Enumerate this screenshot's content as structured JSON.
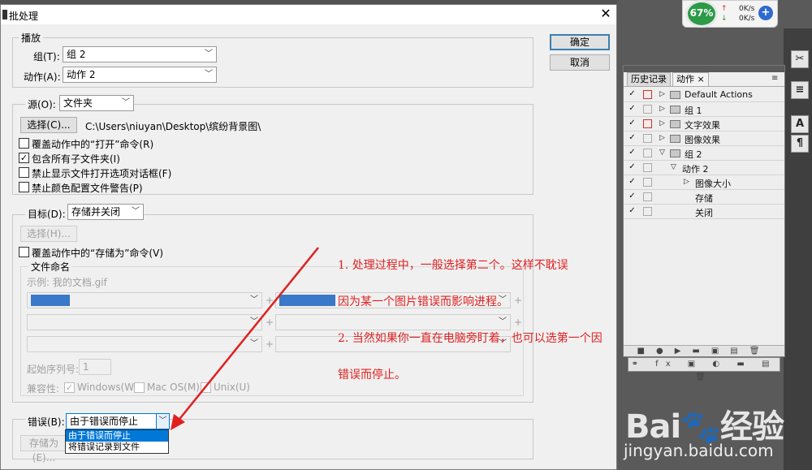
{
  "dialog": {
    "title": "批处理",
    "ok_label": "确定",
    "cancel_label": "取消",
    "play": {
      "legend": "播放",
      "set_label": "组(T):",
      "set_value": "组 2",
      "action_label": "动作(A):",
      "action_value": "动作 2"
    },
    "source": {
      "label": "源(O):",
      "value": "文件夹",
      "choose_label": "选择(C)...",
      "path": "C:\\Users\\niuyan\\Desktop\\缤纷背景图\\",
      "checkboxes": [
        {
          "label": "覆盖动作中的“打开”命令(R)",
          "checked": false
        },
        {
          "label": "包含所有子文件夹(I)",
          "checked": true
        },
        {
          "label": "禁止显示文件打开选项对话框(F)",
          "checked": false
        },
        {
          "label": "禁止颜色配置文件警告(P)",
          "checked": false
        }
      ]
    },
    "destination": {
      "label": "目标(D):",
      "value": "存储并关闭",
      "choose_label": "选择(H)...",
      "override_label": "覆盖动作中的“存储为”命令(V)",
      "file_naming": {
        "legend": "文件命名",
        "example": "示例: 我的文档.gif",
        "start_serial_label": "起始序列号:",
        "start_serial_value": "1",
        "compat_label": "兼容性:",
        "compat_options": [
          {
            "label": "Windows(W)",
            "checked": true
          },
          {
            "label": "Mac OS(M)",
            "checked": false
          },
          {
            "label": "Unix(U)",
            "checked": false
          }
        ]
      }
    },
    "errors": {
      "label": "错误(B):",
      "value": "由于错误而停止",
      "save_as_label": "存储为(E)...",
      "options": [
        "由于错误而停止",
        "将错误记录到文件"
      ]
    }
  },
  "annotation": {
    "lines": [
      "1. 处理过程中，一般选择第二个。这样不耽误",
      "因为某一个图片错误而影响进程。",
      "2. 当然如果你一直在电脑旁盯着，也可以选第一个因",
      "错误而停止。"
    ],
    "color": "#e02020"
  },
  "widget": {
    "percent": "67%",
    "up_speed": "0K/s",
    "down_speed": "0K/s"
  },
  "panel": {
    "tabs": [
      "历史记录",
      "动作"
    ],
    "rows": [
      {
        "label": "Default Actions",
        "kind": "set",
        "red": true
      },
      {
        "label": "组 1",
        "kind": "set",
        "red": false
      },
      {
        "label": "文字效果",
        "kind": "set",
        "red": true
      },
      {
        "label": "图像效果",
        "kind": "set",
        "red": false
      },
      {
        "label": "组 2",
        "kind": "set-open",
        "red": false
      },
      {
        "label": "动作 2",
        "kind": "action",
        "red": false
      },
      {
        "label": "图像大小",
        "kind": "step",
        "red": false
      },
      {
        "label": "存储",
        "kind": "step-leaf",
        "red": false
      },
      {
        "label": "关闭",
        "kind": "step-leaf",
        "red": false
      }
    ]
  },
  "watermark": {
    "logo": "Bai🐾经验",
    "url": "jingyan.baidu.com"
  }
}
